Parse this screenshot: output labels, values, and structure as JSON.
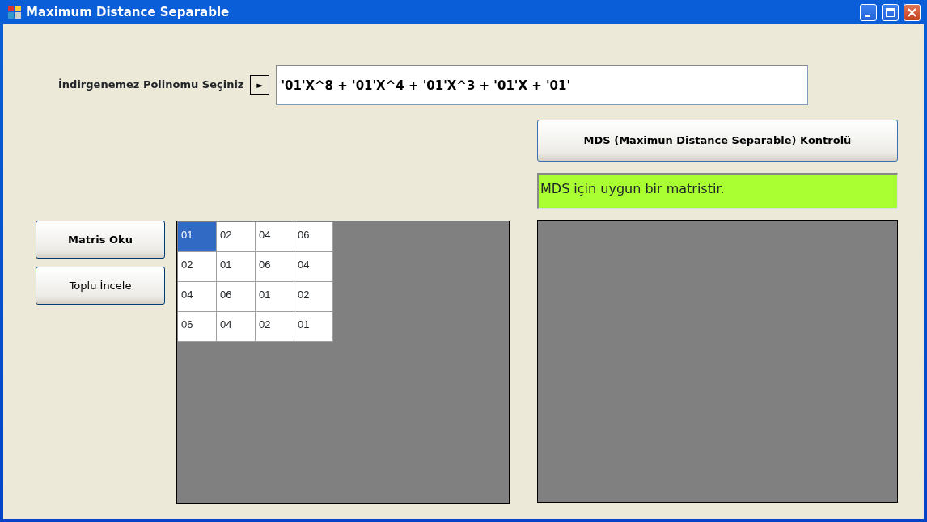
{
  "window": {
    "title": "Maximum Distance Separable"
  },
  "polynomial": {
    "label": "İndirgenemez Polinomu Seçiniz",
    "picker_button": "►",
    "value": "'01'X^8 + '01'X^4 + '01'X^3 + '01'X + '01'"
  },
  "buttons": [
    {
      "label": "Matris Oku",
      "bold": true
    },
    {
      "label": "Toplu İncele",
      "bold": false
    }
  ],
  "matrix": {
    "rows": [
      [
        {
          "text": "01",
          "selected": true
        },
        {
          "text": "02",
          "selected": false
        },
        {
          "text": "04",
          "selected": false
        },
        {
          "text": "06",
          "selected": false
        }
      ],
      [
        {
          "text": "02",
          "selected": false
        },
        {
          "text": "01",
          "selected": false
        },
        {
          "text": "06",
          "selected": false
        },
        {
          "text": "04",
          "selected": false
        }
      ],
      [
        {
          "text": "04",
          "selected": false
        },
        {
          "text": "06",
          "selected": false
        },
        {
          "text": "01",
          "selected": false
        },
        {
          "text": "02",
          "selected": false
        }
      ],
      [
        {
          "text": "06",
          "selected": false
        },
        {
          "text": "04",
          "selected": false
        },
        {
          "text": "02",
          "selected": false
        },
        {
          "text": "01",
          "selected": false
        }
      ]
    ]
  },
  "check_button": {
    "label": "MDS (Maximun Distance Separable) Kontrolü"
  },
  "result": {
    "text": "MDS için uygun bir matristir.",
    "color": "#aaff33"
  }
}
